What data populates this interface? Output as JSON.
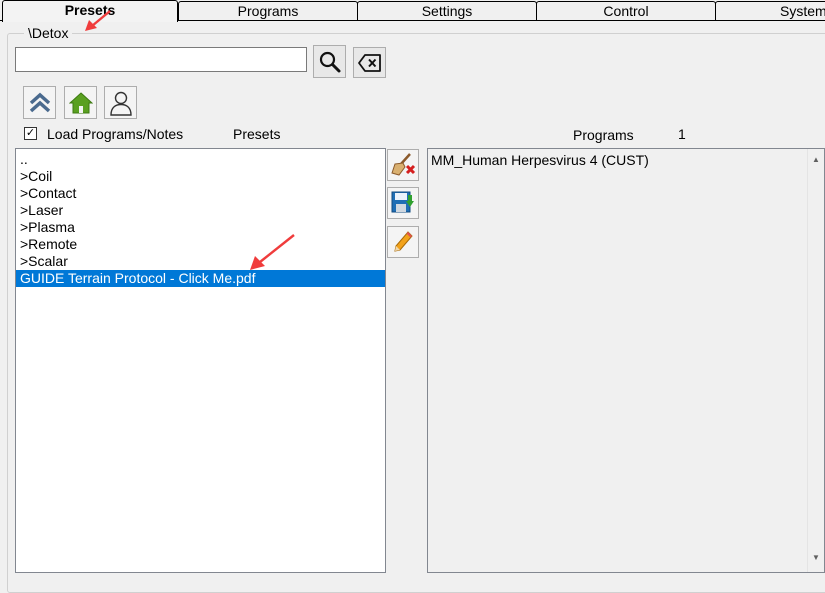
{
  "tabs": [
    {
      "label": "Presets",
      "active": true
    },
    {
      "label": "Programs",
      "active": false
    },
    {
      "label": "Settings",
      "active": false
    },
    {
      "label": "Control",
      "active": false
    },
    {
      "label": "System",
      "active": false
    }
  ],
  "path": "\\Detox",
  "search": {
    "value": "",
    "placeholder": ""
  },
  "load_option": {
    "label": "Load Programs/Notes",
    "checked": true
  },
  "presets_panel": {
    "header": "Presets",
    "items": [
      {
        "label": ".."
      },
      {
        "label": ">Coil"
      },
      {
        "label": ">Contact"
      },
      {
        "label": ">Laser"
      },
      {
        "label": ">Plasma"
      },
      {
        "label": ">Remote"
      },
      {
        "label": ">Scalar"
      },
      {
        "label": "GUIDE Terrain Protocol - Click Me.pdf",
        "selected": true
      }
    ]
  },
  "programs_panel": {
    "header": "Programs",
    "count": "1",
    "items": [
      {
        "label": "MM_Human Herpesvirus 4 (CUST)"
      }
    ]
  },
  "icons": {
    "search": "magnifier-icon",
    "clear": "backspace-clear-icon",
    "up": "double-chevron-up-icon",
    "home": "home-icon",
    "user": "user-icon",
    "clear_list": "broom-delete-icon",
    "save": "save-icon",
    "edit": "pencil-icon"
  },
  "colors": {
    "selection": "#0078d7",
    "annotation_arrow": "#f03c3c",
    "home_green": "#5aa020"
  }
}
